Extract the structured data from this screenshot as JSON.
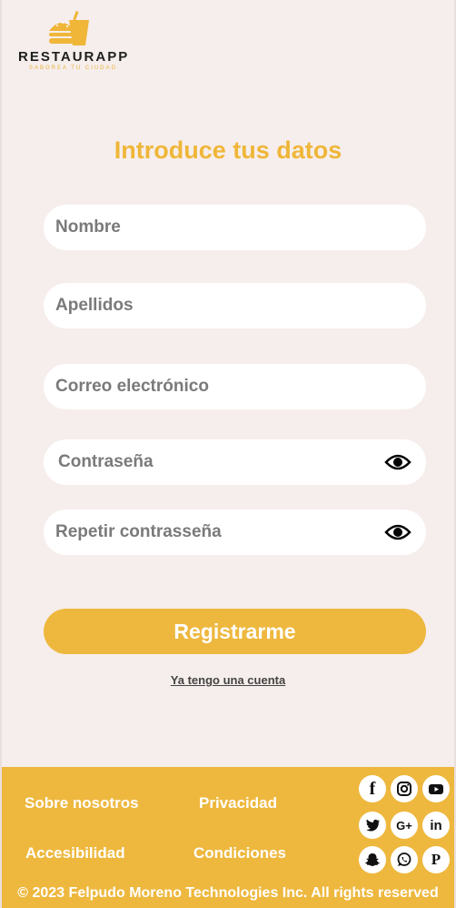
{
  "brand": {
    "name": "RESTAURAPP",
    "tagline": "SABOREA TU CIUDAD",
    "accent": "#eeb83e"
  },
  "form": {
    "title": "Introduce tus datos",
    "fields": [
      {
        "placeholder": "Nombre"
      },
      {
        "placeholder": "Apellidos"
      },
      {
        "placeholder": "Correo electrónico"
      },
      {
        "placeholder": "Contraseña"
      },
      {
        "placeholder": "Repetir contrasseña"
      }
    ],
    "submit_label": "Registrarme",
    "login_link": "Ya tengo una cuenta"
  },
  "footer": {
    "links": [
      "Sobre nosotros",
      "Privacidad",
      "Accesibilidad",
      "Condiciones"
    ],
    "copyright": "© 2023 Felpudo Moreno Technologies Inc. All rights reserved",
    "social": [
      "facebook-icon",
      "instagram-icon",
      "youtube-icon",
      "twitter-icon",
      "google-plus-icon",
      "linkedin-icon",
      "snapchat-icon",
      "whatsapp-icon",
      "pinterest-icon"
    ],
    "social_glyphs": {
      "facebook": "f",
      "google_plus": "G+",
      "linkedin": "in",
      "pinterest": "P"
    }
  }
}
